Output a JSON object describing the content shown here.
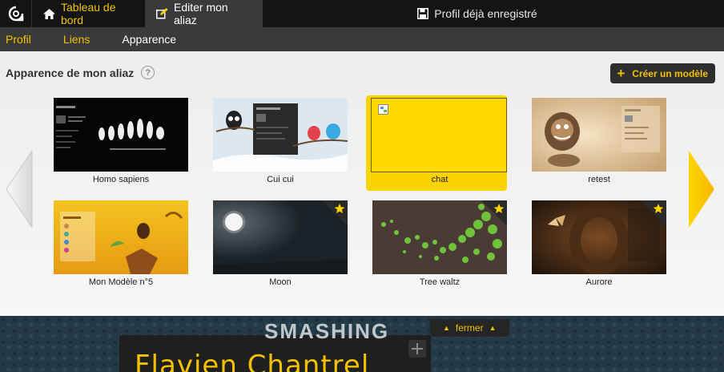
{
  "topbar": {
    "dashboard_label": "Tableau de bord",
    "edit_label": "Editer mon aliaz",
    "saved_label": "Profil déjà enregistré"
  },
  "subnav": {
    "items": [
      {
        "label": "Profil"
      },
      {
        "label": "Liens"
      },
      {
        "label": "Apparence"
      }
    ]
  },
  "panel": {
    "title": "Apparence de mon aliaz",
    "help": "?",
    "create_button": "Créer un modèle"
  },
  "templates": [
    {
      "name": "Homo sapiens",
      "selected": false,
      "favorite": false
    },
    {
      "name": "Cui cui",
      "selected": false,
      "favorite": false
    },
    {
      "name": "chat",
      "selected": true,
      "favorite": false
    },
    {
      "name": "retest",
      "selected": false,
      "favorite": false
    },
    {
      "name": "Mon Modèle n°5",
      "selected": false,
      "favorite": false
    },
    {
      "name": "Moon",
      "selected": false,
      "favorite": true
    },
    {
      "name": "Tree waltz",
      "selected": false,
      "favorite": true
    },
    {
      "name": "Aurore",
      "selected": false,
      "favorite": true
    }
  ],
  "preview": {
    "close_label": "fermer",
    "banner_text": "SMASHING",
    "profile_name": "Flavien Chantrel"
  },
  "colors": {
    "accent": "#f2c200",
    "topbar": "#141414",
    "subnav": "#3a3a3a",
    "selected_card": "#fbd300"
  }
}
